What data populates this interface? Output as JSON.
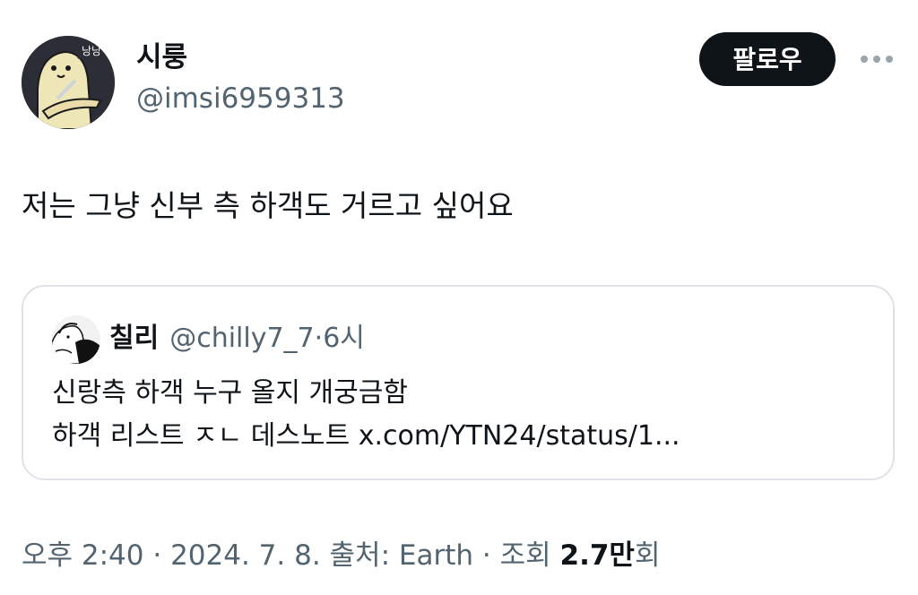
{
  "author": {
    "display_name": "시룽",
    "handle": "@imsi6959313",
    "avatar_text": "낭낭"
  },
  "follow_button": {
    "label": "팔로우"
  },
  "more_menu": {
    "icon": "more-horizontal-icon"
  },
  "tweet": {
    "text": "저는 그냥 신부 측 하객도 거르고 싶어요"
  },
  "quote": {
    "display_name": "칠리",
    "handle": "@chilly7_7",
    "separator": "·",
    "time": "6시",
    "line1": "신랑측 하객 누구 올지 개궁금함",
    "line2": "하객 리스트 ㅈㄴ 데스노트 x.com/YTN24/status/1..."
  },
  "meta": {
    "time": "오후 2:40",
    "sep1": " · ",
    "date": "2024. 7. 8.",
    "source_label": " 출처: ",
    "source": "Earth",
    "sep2": " · ",
    "views_label": "조회 ",
    "views_value": "2.7만",
    "views_suffix": "회"
  },
  "colors": {
    "text": "#0f1419",
    "secondary": "#536471",
    "border": "#dfe3e7",
    "button_bg": "#0f1419"
  }
}
